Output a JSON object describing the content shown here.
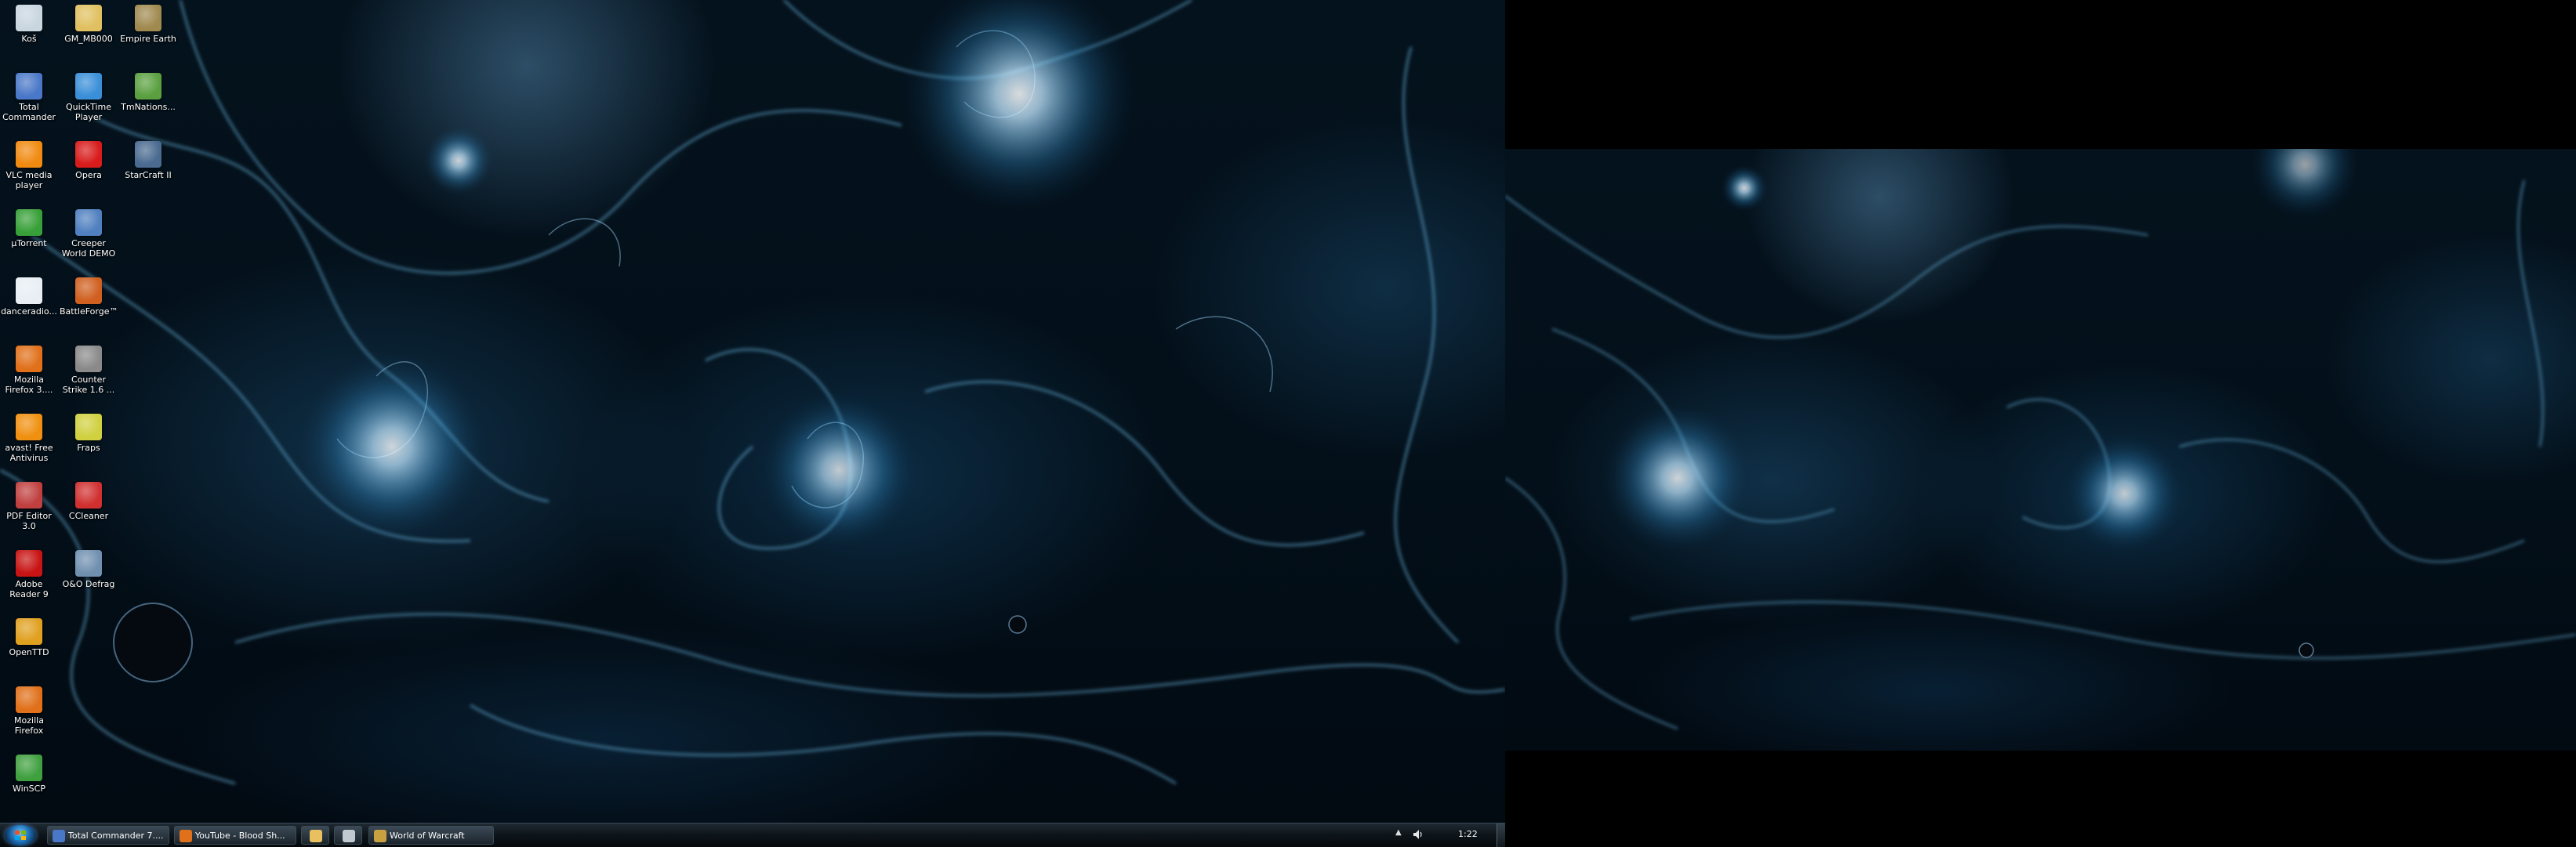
{
  "desktop": {
    "icons": [
      {
        "label": "Koš",
        "icon": "recycle-bin-icon",
        "color": "#c9d6e0"
      },
      {
        "label": "GM_MB000",
        "icon": "gm-app-icon",
        "color": "#e0c060"
      },
      {
        "label": "Empire Earth",
        "icon": "empire-earth-icon",
        "color": "#a08a50"
      },
      {
        "label": "Total Commander",
        "icon": "total-commander-icon",
        "color": "#4a78c8"
      },
      {
        "label": "QuickTime Player",
        "icon": "quicktime-icon",
        "color": "#3a8fd8"
      },
      {
        "label": "TmNations...",
        "icon": "tmnations-icon",
        "color": "#5aa040"
      },
      {
        "label": "VLC media player",
        "icon": "vlc-icon",
        "color": "#f08a10"
      },
      {
        "label": "Opera",
        "icon": "opera-icon",
        "color": "#d81b1b"
      },
      {
        "label": "StarCraft II",
        "icon": "starcraft-icon",
        "color": "#4a6a90"
      },
      {
        "label": "µTorrent",
        "icon": "utorrent-icon",
        "color": "#38a038"
      },
      {
        "label": "Creeper World DEMO",
        "icon": "creeper-world-icon",
        "color": "#5080c0"
      },
      {
        "label": "danceradio...",
        "icon": "file-icon",
        "color": "#e8eef4"
      },
      {
        "label": "BattleForge™",
        "icon": "battleforge-icon",
        "color": "#d06020"
      },
      {
        "label": "Mozilla Firefox 3....",
        "icon": "firefox-icon",
        "color": "#e0701a"
      },
      {
        "label": "Counter Strike 1.6 ...",
        "icon": "counter-strike-icon",
        "color": "#8a8a8a"
      },
      {
        "label": "avast! Free Antivirus",
        "icon": "avast-icon",
        "color": "#f09010"
      },
      {
        "label": "Fraps",
        "icon": "fraps-icon",
        "color": "#d0d040"
      },
      {
        "label": "PDF Editor 3.0",
        "icon": "pdf-editor-icon",
        "color": "#c04040"
      },
      {
        "label": "CCleaner",
        "icon": "ccleaner-icon",
        "color": "#d03030"
      },
      {
        "label": "Adobe Reader 9",
        "icon": "adobe-reader-icon",
        "color": "#c81414"
      },
      {
        "label": "O&O Defrag",
        "icon": "oo-defrag-icon",
        "color": "#7090b0"
      },
      {
        "label": "OpenTTD",
        "icon": "openttd-icon",
        "color": "#e0a020"
      },
      {
        "label": "Mozilla Firefox",
        "icon": "firefox-icon",
        "color": "#e0701a"
      },
      {
        "label": "WinSCP",
        "icon": "winscp-icon",
        "color": "#40a040"
      }
    ]
  },
  "taskbar": {
    "buttons": [
      {
        "label": "Total Commander 7....",
        "icon": "total-commander-icon",
        "color": "#4a78c8"
      },
      {
        "label": "YouTube - Blood Sh...",
        "icon": "firefox-icon",
        "color": "#e0701a"
      },
      {
        "label": "",
        "icon": "folder-icon",
        "color": "#e8c060"
      },
      {
        "label": "",
        "icon": "media-icon",
        "color": "#c0c8d0"
      },
      {
        "label": "World of Warcraft",
        "icon": "wow-icon",
        "color": "#c8a040"
      }
    ],
    "tray": {
      "clock": "1:22",
      "up_arrow": "▲"
    }
  },
  "colors": {
    "accent": "#7cc8ff",
    "wallpaper_dark": "#020a12"
  }
}
